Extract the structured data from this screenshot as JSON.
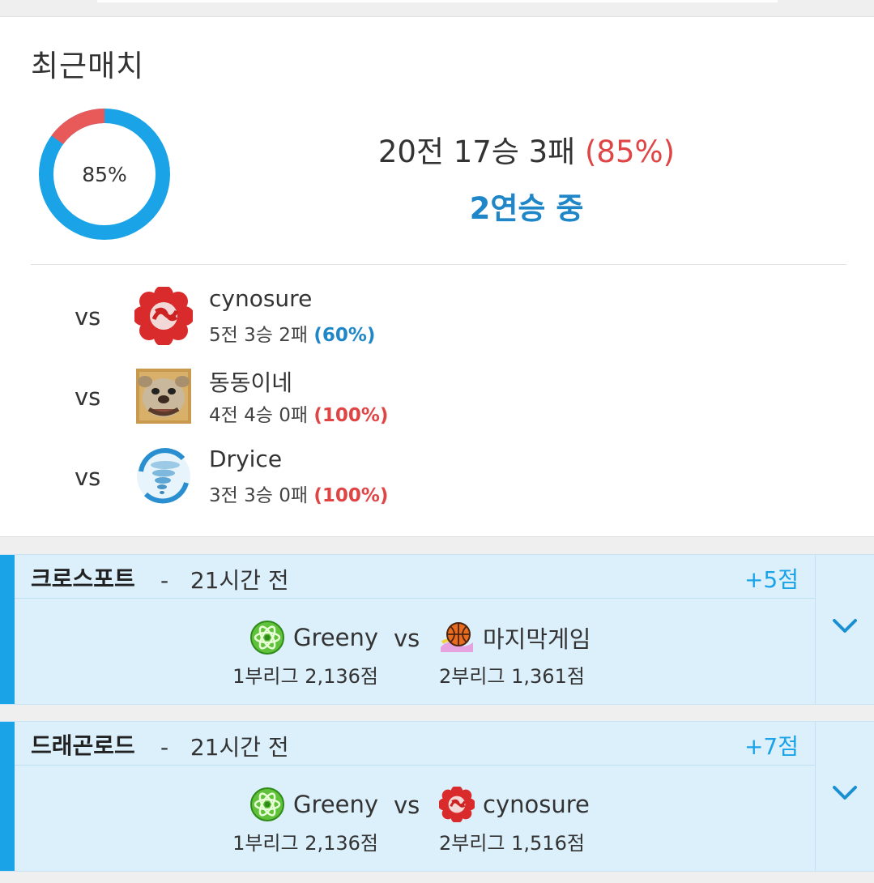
{
  "section_title": "최근매치",
  "summary": {
    "donut_label": "85%",
    "win_fraction": 0.85,
    "record_text": "20전 17승 3패",
    "record_pct": "(85%)",
    "streak": "2연승 중",
    "colors": {
      "win": "#1aa3e6",
      "loss": "#e85a5a"
    }
  },
  "opponents": [
    {
      "vs": "vs",
      "name": "cynosure",
      "record": "5전 3승 2패",
      "pct": "(60%)",
      "pct_color": "blue",
      "icon": "red-flower-emblem-icon"
    },
    {
      "vs": "vs",
      "name": "동동이네",
      "record": "4전 4승 0패",
      "pct": "(100%)",
      "pct_color": "red",
      "icon": "bulldog-icon"
    },
    {
      "vs": "vs",
      "name": "Dryice",
      "record": "3전 3승 0패",
      "pct": "(100%)",
      "pct_color": "red",
      "icon": "tornado-icon"
    }
  ],
  "matches": [
    {
      "game": "크로스포트",
      "separator": "-",
      "time": "21시간 전",
      "points": "+5점",
      "player1": {
        "name": "Greeny",
        "league": "1부리그 2,136점",
        "icon": "green-atom-emblem-icon"
      },
      "vs": "vs",
      "player2": {
        "name": "마지막게임",
        "league": "2부리그 1,361점",
        "icon": "basketball-icon"
      }
    },
    {
      "game": "드래곤로드",
      "separator": "-",
      "time": "21시간 전",
      "points": "+7점",
      "player1": {
        "name": "Greeny",
        "league": "1부리그 2,136점",
        "icon": "green-atom-emblem-icon"
      },
      "vs": "vs",
      "player2": {
        "name": "cynosure",
        "league": "2부리그 1,516점",
        "icon": "red-flower-emblem-icon"
      }
    }
  ]
}
